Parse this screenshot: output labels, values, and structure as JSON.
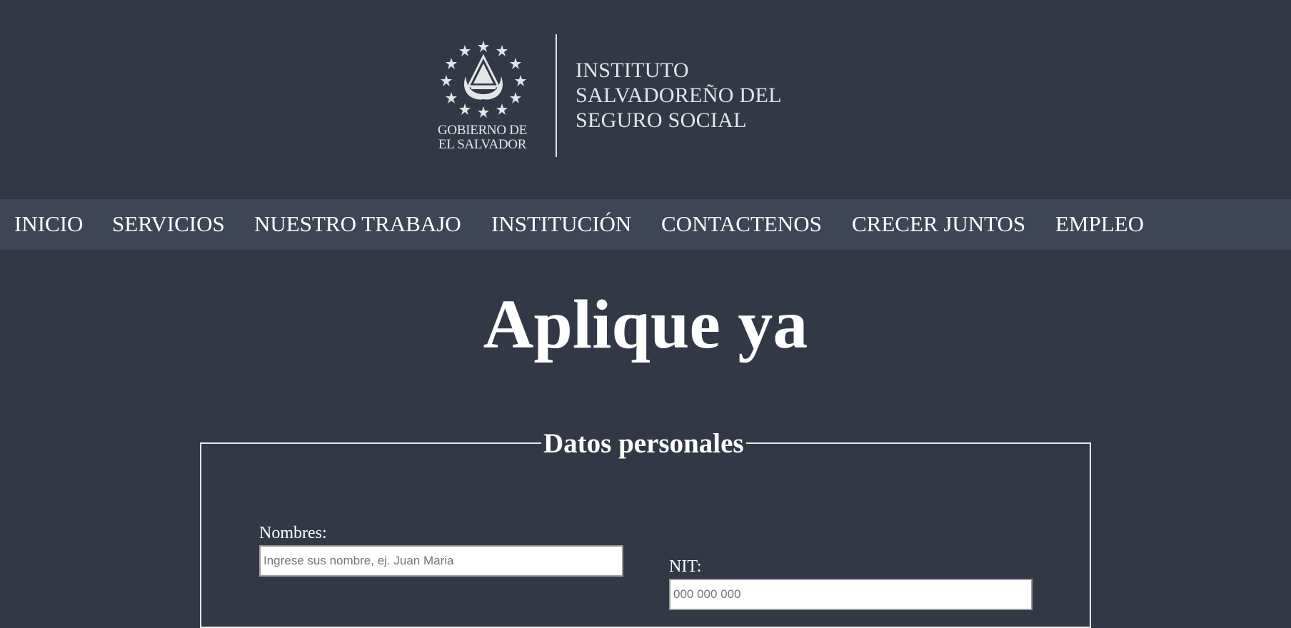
{
  "header": {
    "gov_line1": "GOBIERNO DE",
    "gov_line2": "EL SALVADOR",
    "inst_line1": "INSTITUTO",
    "inst_line2": "SALVADOREÑO DEL",
    "inst_line3": "SEGURO SOCIAL",
    "seal_icon": "el-salvador-coat-of-arms-icon"
  },
  "nav": {
    "items": [
      {
        "label": "INICIO"
      },
      {
        "label": "SERVICIOS"
      },
      {
        "label": "NUESTRO TRABAJO"
      },
      {
        "label": "INSTITUCIÓN"
      },
      {
        "label": "CONTACTENOS"
      },
      {
        "label": "CRECER JUNTOS"
      },
      {
        "label": "EMPLEO"
      }
    ]
  },
  "main": {
    "title": "Aplique ya",
    "fieldset_legend": "Datos personales",
    "fields": {
      "nombres": {
        "label": "Nombres:",
        "value": "",
        "placeholder": "Ingrese sus nombre, ej. Juan Maria"
      },
      "nit": {
        "label": "NIT:",
        "value": "",
        "placeholder": "000 000 000"
      }
    }
  },
  "colors": {
    "background": "#323846",
    "nav_background": "#3e4557",
    "text": "#ffffff",
    "logo_text": "#e3e5e9"
  }
}
